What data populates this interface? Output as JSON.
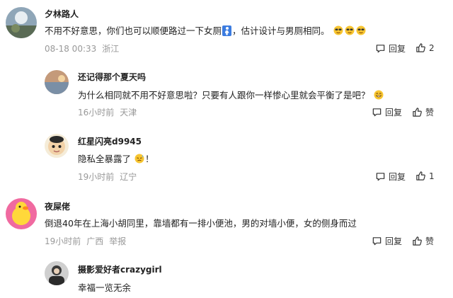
{
  "comments": [
    {
      "user": "夕林路人",
      "text_a": "不用不好意思，你们也可以顺便路过一下女厕",
      "text_b": "，估计设计与男厕相同。",
      "time": "08-18 00:33",
      "location": "浙江",
      "reply_label": "回复",
      "like_value": "2",
      "emojis": [
        "cool-face-emoji",
        "cool-face-emoji",
        "cool-face-emoji"
      ]
    },
    {
      "user": "还记得那个夏天吗",
      "text": "为什么相同就不用不好意思啦？只要有人跟你一样惨心里就会平衡了是吧？",
      "time": "16小时前",
      "location": "天津",
      "reply_label": "回复",
      "like_value": "赞",
      "emojis": [
        "grin-face-emoji"
      ]
    },
    {
      "user": "红星闪亮d9945",
      "text": "隐私全暴露了",
      "text_tail": "！",
      "time": "19小时前",
      "location": "辽宁",
      "reply_label": "回复",
      "like_value": "1",
      "emojis": [
        "sweat-face-emoji"
      ]
    },
    {
      "user": "夜屎佬",
      "text": "倒退40年在上海小胡同里，靠墙都有一排小便池，男的对墙小便，女的侧身而过",
      "time": "19小时前",
      "location": "广西",
      "report_label": "举报",
      "reply_label": "回复",
      "like_value": "赞"
    },
    {
      "user": "摄影爱好者crazygirl",
      "text": "幸福一览无余"
    }
  ]
}
